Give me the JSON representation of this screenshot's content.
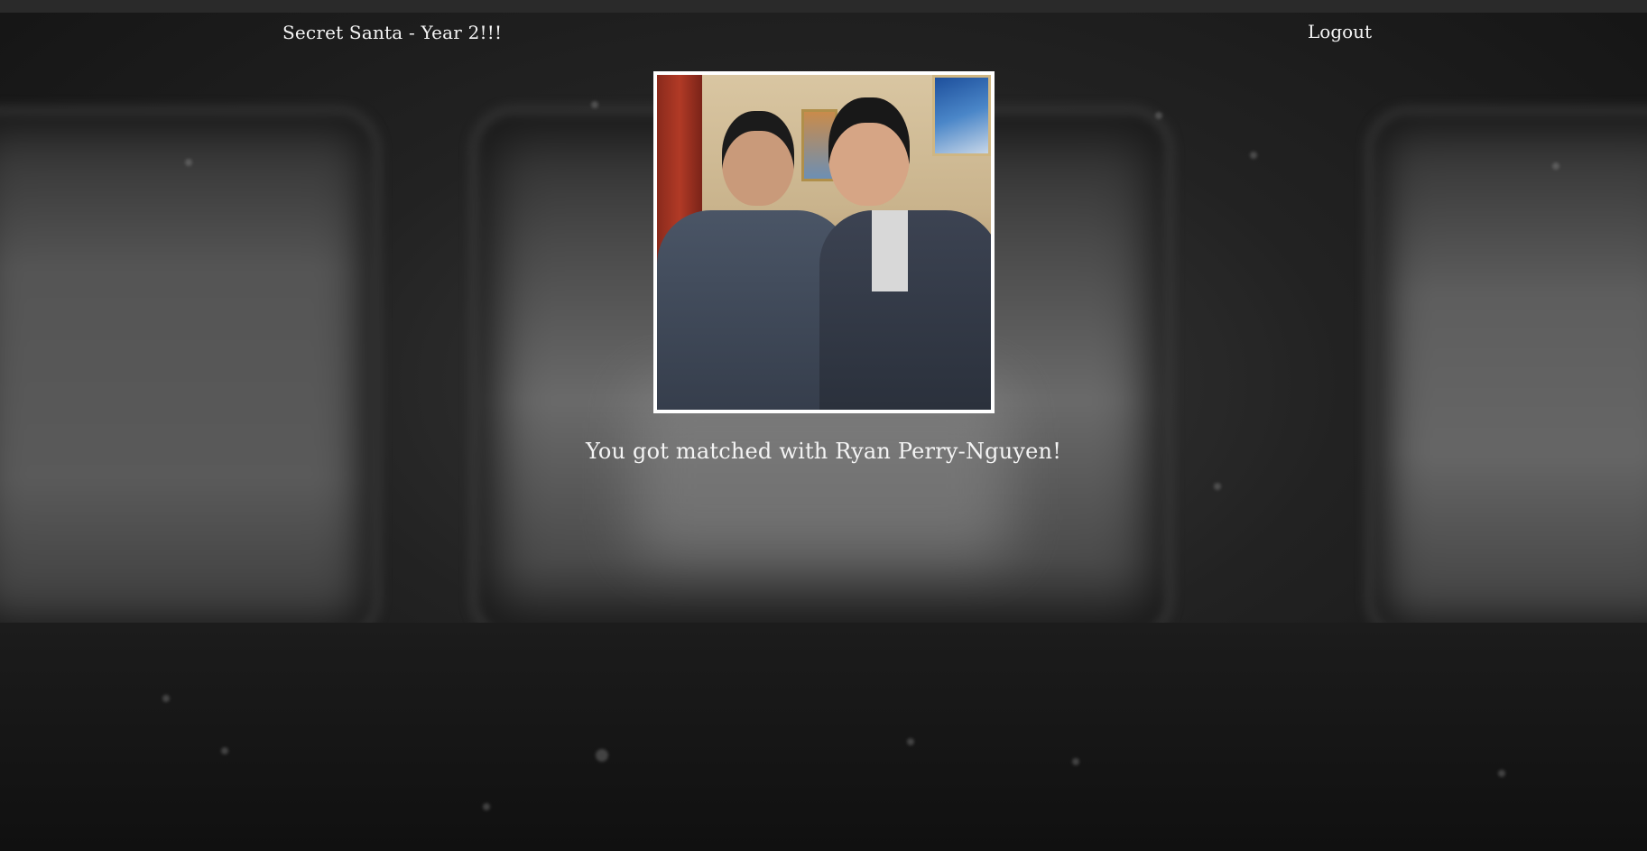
{
  "nav": {
    "brand": "Secret Santa - Year 2!!!",
    "logout": "Logout"
  },
  "main": {
    "photo_alt": "Ryan Perry-Nguyen",
    "match_text": "You got matched with Ryan Perry-Nguyen!"
  },
  "colors": {
    "background": "#141414",
    "text": "#f2f2f2",
    "photo_border": "#ffffff"
  }
}
